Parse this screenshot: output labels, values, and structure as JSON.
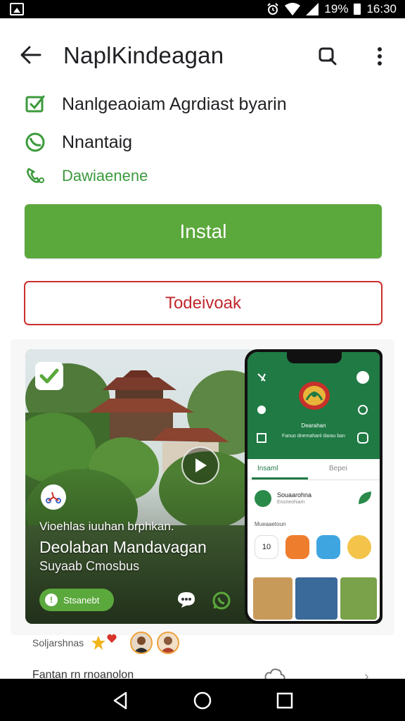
{
  "status_bar": {
    "battery": "19%",
    "time": "16:30",
    "icons": [
      "gallery-icon",
      "alarm-icon",
      "wifi-icon",
      "signal-icon",
      "battery-icon"
    ]
  },
  "app_bar": {
    "title": "NaplKindeagan",
    "icons": [
      "back-arrow-icon",
      "search-icon",
      "more-vert-icon"
    ]
  },
  "info_rows": [
    {
      "icon": "verified-check-icon",
      "text": "Nanlgeaoiam Agrdiast byarin"
    },
    {
      "icon": "clock-icon",
      "text": "Nnantaig"
    },
    {
      "icon": "phone-icon",
      "text": "Dawiaenene"
    }
  ],
  "buttons": {
    "install": "Instal",
    "secondary": "Todeivoak"
  },
  "media": {
    "line1": "Vioehlas iuuhan brphkan.",
    "line2": "Deolaban Mandavagan",
    "line3": "Suyaab Cmosbus",
    "pill": "Stsanebt",
    "pill_icon": "!",
    "icons": [
      "verified-badge-icon",
      "play-icon",
      "scooter-icon",
      "chat-bubble-icon",
      "whatsapp-icon"
    ],
    "phone": {
      "title": "Dearahan",
      "subtitle": "Fanuo dnemahanl darau ban",
      "tab_active": "Insaml",
      "tab_inactive": "Bepei",
      "list_title": "Souaarohna",
      "list_sub": "Enorieohiarn",
      "section": "Mueaaetoun",
      "tile_number": "10"
    }
  },
  "reviews": {
    "label": "Soljarshnas"
  },
  "bottom_item": {
    "label": "Fantan rn rnoanolon"
  },
  "colors": {
    "accent_green": "#5ba83c",
    "dark_green": "#1f7a44",
    "outline_red": "#c9302c"
  }
}
